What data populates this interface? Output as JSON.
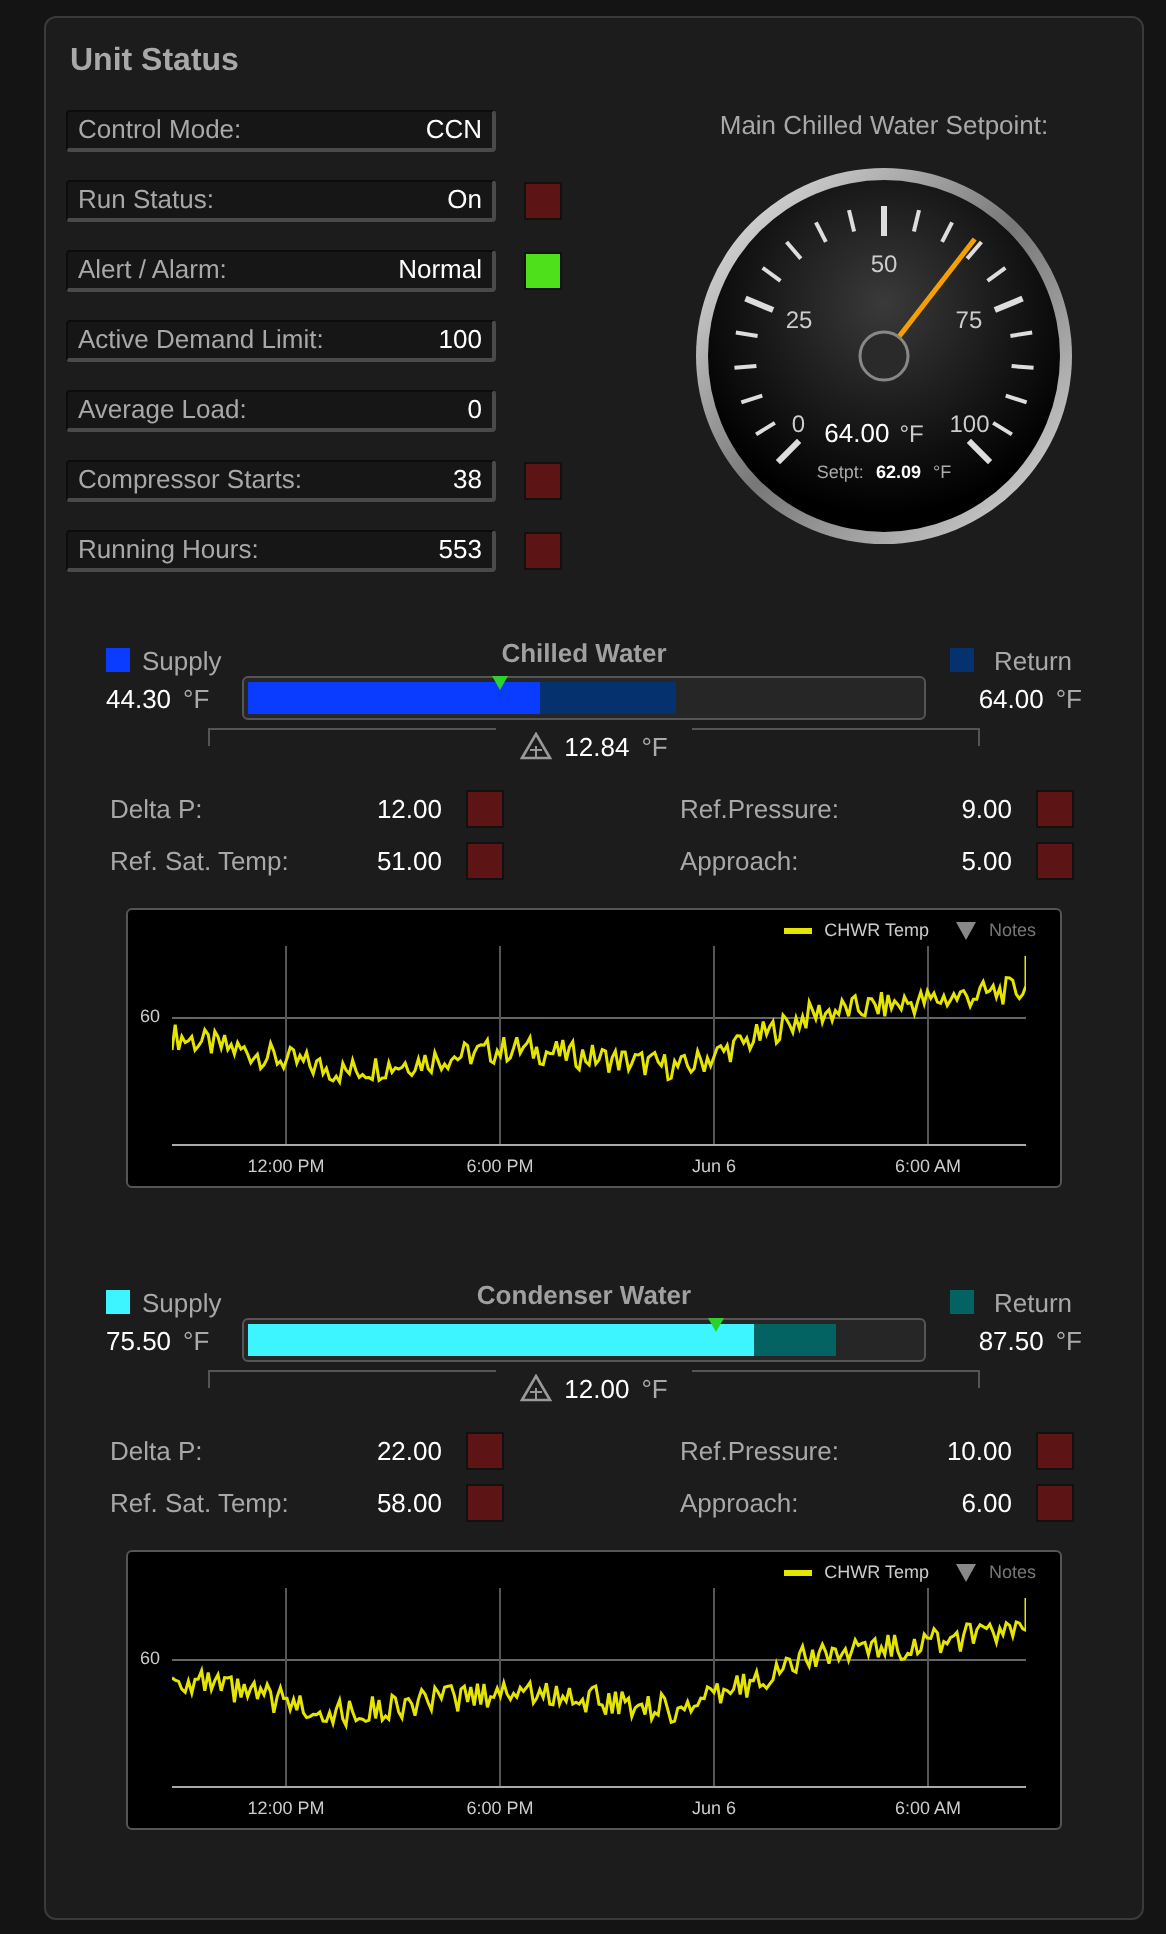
{
  "title": "Unit Status",
  "status_fields": [
    {
      "label": "Control Mode:",
      "value": "CCN"
    },
    {
      "label": "Run Status:",
      "value": "On",
      "color": "#5c1414"
    },
    {
      "label": "Alert / Alarm:",
      "value": "Normal",
      "color": "#4ee01a"
    },
    {
      "label": "Active Demand Limit:",
      "value": "100"
    },
    {
      "label": "Average Load:",
      "value": "0"
    },
    {
      "label": "Compressor Starts:",
      "value": "38",
      "color": "#5c1414"
    },
    {
      "label": "Running Hours:",
      "value": "553",
      "color": "#5c1414"
    }
  ],
  "gauge": {
    "title": "Main Chilled Water Setpoint:",
    "scale_labels": [
      "0",
      "25",
      "50",
      "75",
      "100"
    ],
    "value": "64.00",
    "unit": "°F",
    "setpoint_label": "Setpt:",
    "setpoint_value": "62.09",
    "setpoint_unit": "°F"
  },
  "loops": [
    {
      "title": "Chilled Water",
      "supply": {
        "label": "Supply",
        "value": "44.30",
        "unit": "°F",
        "color": "#0a3cff",
        "level": 0.44
      },
      "return": {
        "label": "Return",
        "value": "64.00",
        "unit": "°F",
        "color": "#05326e",
        "level": 0.64
      },
      "marker": {
        "level": 0.375
      },
      "delta": {
        "value": "12.84",
        "unit": "°F"
      },
      "readings": [
        {
          "label": "Delta P:",
          "value": "12.00",
          "color": "#5c1414"
        },
        {
          "label": "Ref.Pressure:",
          "value": "9.00",
          "color": "#5c1414"
        },
        {
          "label": "Ref. Sat. Temp:",
          "value": "51.00",
          "color": "#5c1414"
        },
        {
          "label": "Approach:",
          "value": "5.00",
          "color": "#5c1414"
        }
      ],
      "trend": {
        "legend": "CHWR Temp",
        "notes": "Notes",
        "y_label": "60",
        "x_labels": [
          "12:00 PM",
          "6:00 PM",
          "Jun 6",
          "6:00 AM"
        ]
      }
    },
    {
      "title": "Condenser Water",
      "supply": {
        "label": "Supply",
        "value": "75.50",
        "unit": "°F",
        "color": "#3cf5ff",
        "level": 0.755
      },
      "return": {
        "label": "Return",
        "value": "87.50",
        "unit": "°F",
        "color": "#036363",
        "level": 0.875
      },
      "marker": {
        "level": 0.695
      },
      "delta": {
        "value": "12.00",
        "unit": "°F"
      },
      "readings": [
        {
          "label": "Delta P:",
          "value": "22.00",
          "color": "#5c1414"
        },
        {
          "label": "Ref.Pressure:",
          "value": "10.00",
          "color": "#5c1414"
        },
        {
          "label": "Ref. Sat. Temp:",
          "value": "58.00",
          "color": "#5c1414"
        },
        {
          "label": "Approach:",
          "value": "6.00",
          "color": "#5c1414"
        }
      ],
      "trend": {
        "legend": "CHWR Temp",
        "notes": "Notes",
        "y_label": "60",
        "x_labels": [
          "12:00 PM",
          "6:00 PM",
          "Jun 6",
          "6:00 AM"
        ]
      }
    }
  ]
}
